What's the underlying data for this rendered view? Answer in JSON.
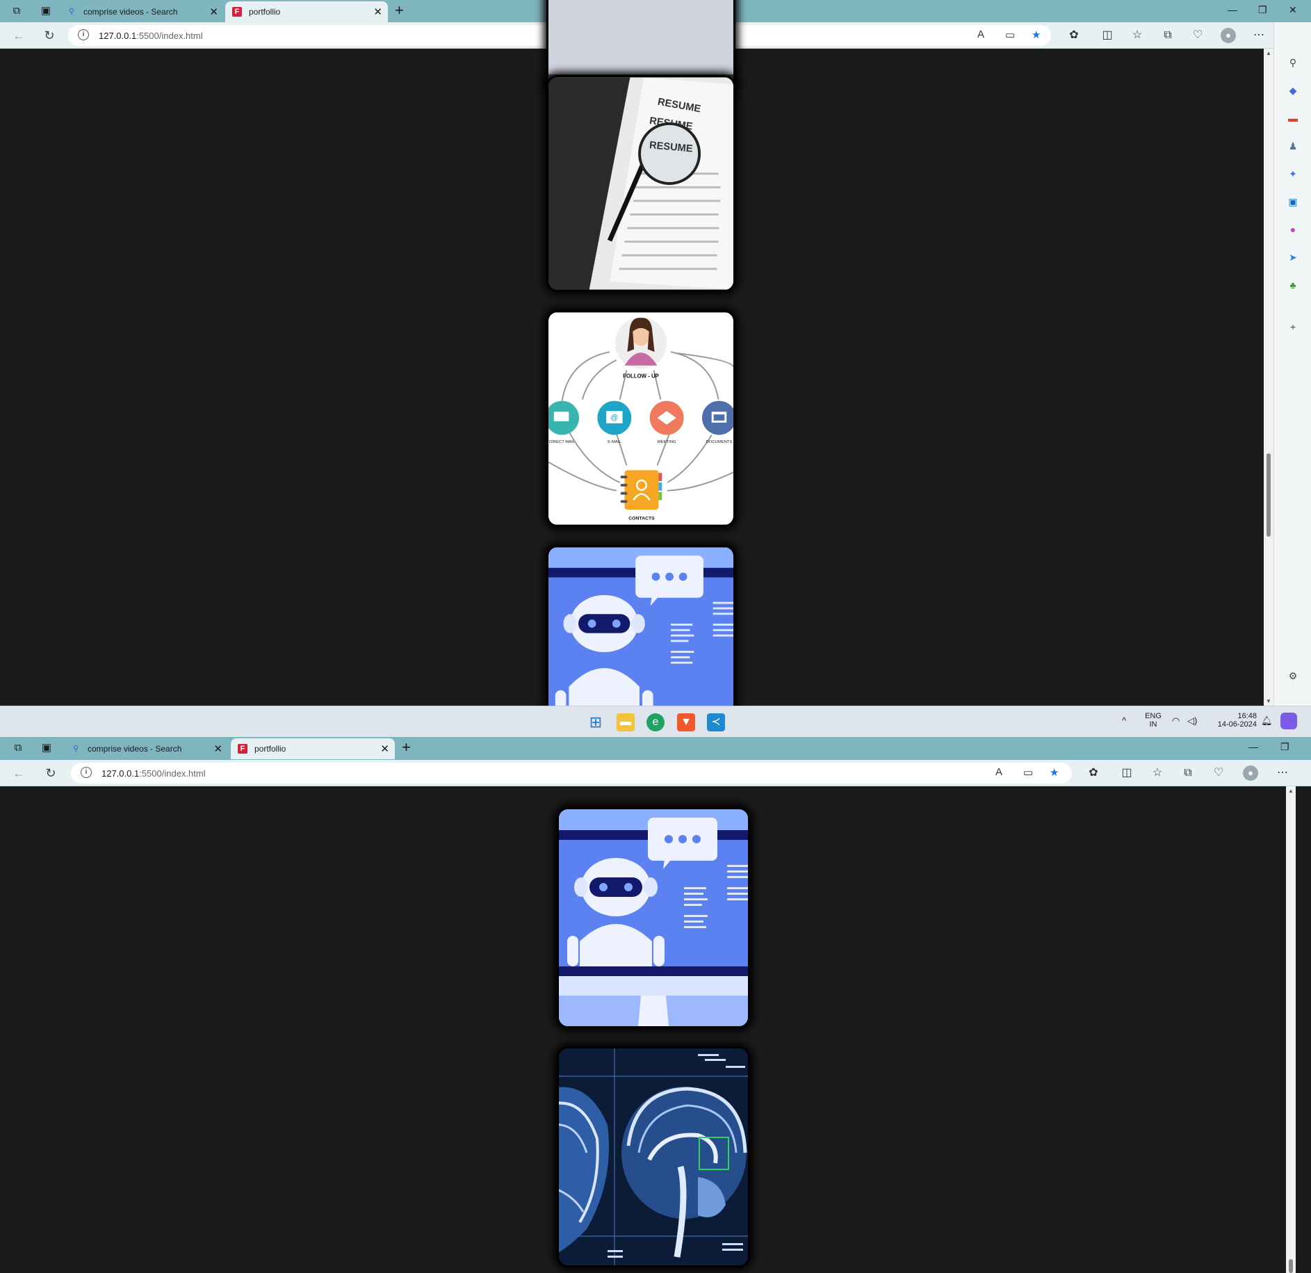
{
  "browser": {
    "tabs": [
      {
        "label": "comprise videos - Search",
        "icon": "search-icon"
      },
      {
        "label": "portfollio",
        "icon": "portfolio-favicon"
      }
    ],
    "favicon_letter": "F",
    "url_host": "127.0.0.1",
    "url_rest": ":5500/index.html",
    "info_glyph": "i"
  },
  "page": {
    "cards": [
      {
        "name": "resume-magnifier-image",
        "texts": [
          "RESUME",
          "RESUME",
          "RESUME"
        ]
      },
      {
        "name": "follow-up-diagram-image",
        "texts": [
          "FOLLOW - UP",
          "DIRECT MAIL",
          "E-MAIL",
          "MEETING",
          "DOCUMENTS",
          "CONTACTS"
        ]
      },
      {
        "name": "chatbot-robot-image",
        "texts": []
      },
      {
        "name": "brain-mri-scan-image",
        "texts": []
      }
    ]
  },
  "taskbar": {
    "language": "ENG",
    "region": "IN",
    "time": "16:48",
    "date": "14-06-2024"
  },
  "colors": {
    "tabstrip": "#7fb5be",
    "navbar": "#e7f1f3",
    "page_background": "#1b1b1b",
    "favicon_red": "#d6203c",
    "star_blue": "#1a73e8"
  }
}
